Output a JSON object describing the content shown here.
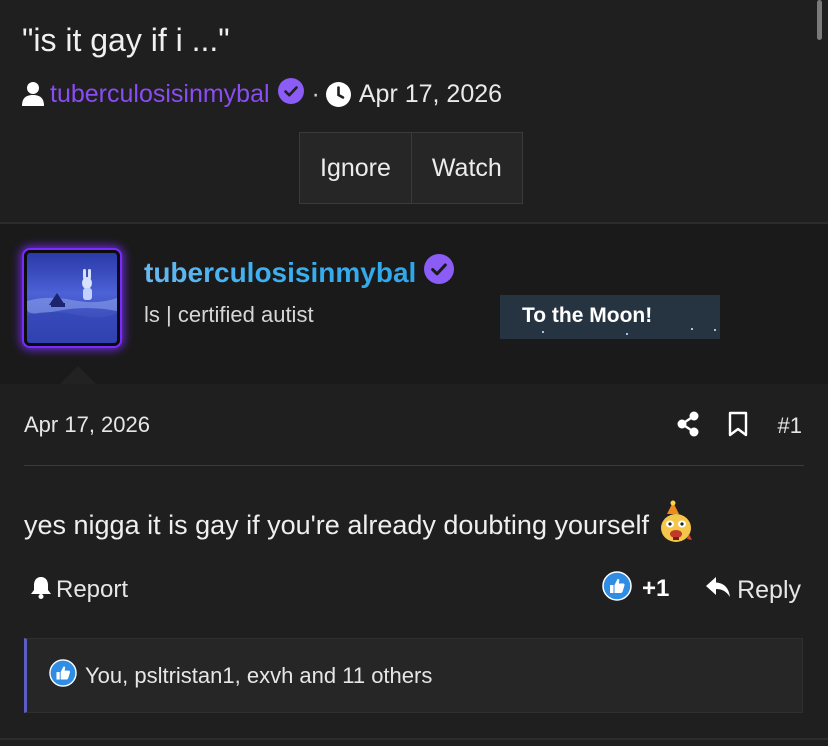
{
  "thread": {
    "title": "\"is it gay if i ...\"",
    "author": "tuberculosisinmybal",
    "separator": "·",
    "date": "Apr 17, 2026",
    "ignore_label": "Ignore",
    "watch_label": "Watch"
  },
  "post": {
    "username": "tuberculosisinmybal",
    "user_title": "ls | certified autist",
    "banner": "To the Moon!",
    "date": "Apr 17, 2026",
    "number": "#1",
    "body": "yes nigga it is gay if you're already doubting yourself",
    "report_label": "Report",
    "reaction_count": "+1",
    "reply_label": "Reply",
    "reactions_text": "You, psltristan1, exvh and 11 others"
  },
  "colors": {
    "background": "#1f1f1f",
    "author_purple": "#8a4cf4",
    "username_blue": "#3fb1f0",
    "verified_badge": "#8b5cf6",
    "like_blue": "#2f8de4",
    "reactions_accent": "#5c5ec8",
    "banner_bg": "#263340"
  },
  "icons": {
    "author": "user-icon",
    "verified": "verified-check-icon",
    "date": "clock-icon",
    "share": "share-icon",
    "bookmark": "bookmark-icon",
    "report": "bell-icon",
    "like": "thumbs-up-icon",
    "reply": "reply-arrow-icon",
    "emoji": "laughing-emoji-icon"
  }
}
